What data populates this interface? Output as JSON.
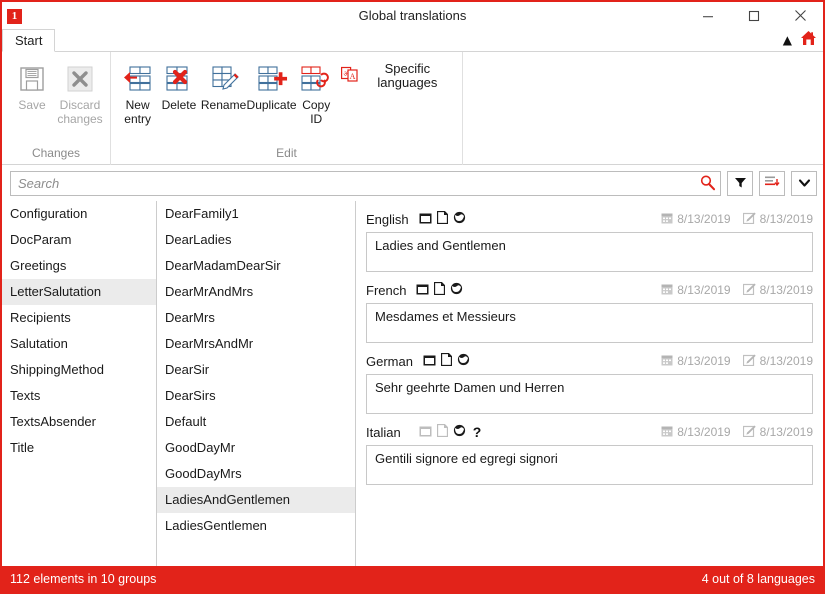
{
  "window": {
    "title": "Global translations",
    "app_icon": "1",
    "controls": {
      "minimize": "minimize-icon",
      "maximize": "maximize-icon",
      "close": "close-icon"
    }
  },
  "ribbon": {
    "tab": "Start",
    "collapse_icon": "chevron-up-icon",
    "home_icon": "home-icon",
    "groups": [
      {
        "label": "Changes",
        "buttons": [
          {
            "label": "Save",
            "icon": "save-floppy-icon",
            "disabled": true
          },
          {
            "label": "Discard changes",
            "icon": "discard-x-icon",
            "disabled": true
          }
        ]
      },
      {
        "label": "Edit",
        "buttons": [
          {
            "label": "New entry",
            "icon": "new-entry-icon",
            "disabled": false
          },
          {
            "label": "Delete",
            "icon": "delete-icon",
            "disabled": false
          },
          {
            "label": "Rename",
            "icon": "rename-icon",
            "disabled": false
          },
          {
            "label": "Duplicate",
            "icon": "duplicate-icon",
            "disabled": false
          },
          {
            "label": "Copy ID",
            "icon": "copy-id-icon",
            "disabled": false
          }
        ],
        "inline_buttons": [
          {
            "label": "Specific languages",
            "icon": "specific-languages-icon"
          }
        ]
      }
    ]
  },
  "search": {
    "value": "",
    "placeholder": "Search",
    "search_icon": "search-icon",
    "filter_icon": "filter-funnel-icon",
    "sort_icon": "sort-descending-icon",
    "more_icon": "chevron-down-icon"
  },
  "groups_list": {
    "selected": "LetterSalutation",
    "items": [
      {
        "label": "Configuration"
      },
      {
        "label": "DocParam"
      },
      {
        "label": "Greetings"
      },
      {
        "label": "LetterSalutation"
      },
      {
        "label": "Recipients"
      },
      {
        "label": "Salutation"
      },
      {
        "label": "ShippingMethod"
      },
      {
        "label": "Texts"
      },
      {
        "label": "TextsAbsender"
      },
      {
        "label": "Title"
      }
    ]
  },
  "entries_list": {
    "selected": "LadiesAndGentlemen",
    "items": [
      {
        "label": "DearFamily1"
      },
      {
        "label": "DearLadies"
      },
      {
        "label": "DearMadamDearSir"
      },
      {
        "label": "DearMrAndMrs"
      },
      {
        "label": "DearMrs"
      },
      {
        "label": "DearMrsAndMr"
      },
      {
        "label": "DearSir"
      },
      {
        "label": "DearSirs"
      },
      {
        "label": "Default"
      },
      {
        "label": "GoodDayMr"
      },
      {
        "label": "GoodDayMrs"
      },
      {
        "label": "LadiesAndGentlemen"
      },
      {
        "label": "LadiesGentlemen"
      }
    ]
  },
  "detail": {
    "languages": [
      {
        "name": "English",
        "value": "Ladies and Gentlemen",
        "icons": [
          "window-icon",
          "document-icon",
          "globe-icon"
        ],
        "icons_disabled": false,
        "has_question": false,
        "created_date": "8/13/2019",
        "modified_date": "8/13/2019",
        "created_icon": "calendar-icon",
        "modified_icon": "edit-pencil-icon"
      },
      {
        "name": "French",
        "value": "Mesdames et Messieurs",
        "icons": [
          "window-icon",
          "document-icon",
          "globe-icon"
        ],
        "icons_disabled": false,
        "has_question": false,
        "created_date": "8/13/2019",
        "modified_date": "8/13/2019",
        "created_icon": "calendar-icon",
        "modified_icon": "edit-pencil-icon"
      },
      {
        "name": "German",
        "value": "Sehr geehrte Damen und Herren",
        "icons": [
          "window-icon",
          "document-icon",
          "globe-icon"
        ],
        "icons_disabled": false,
        "has_question": false,
        "created_date": "8/13/2019",
        "modified_date": "8/13/2019",
        "created_icon": "calendar-icon",
        "modified_icon": "edit-pencil-icon"
      },
      {
        "name": "Italian",
        "value": "Gentili signore ed egregi signori",
        "icons": [
          "window-icon",
          "document-icon",
          "globe-icon",
          "question-icon"
        ],
        "icons_disabled": true,
        "has_question": true,
        "question_label": "?",
        "created_date": "8/13/2019",
        "modified_date": "8/13/2019",
        "created_icon": "calendar-icon",
        "modified_icon": "edit-pencil-icon"
      }
    ]
  },
  "statusbar": {
    "left": "112 elements in 10 groups",
    "right": "4 out of 8 languages"
  },
  "colors": {
    "accent": "#e2231a",
    "selection": "#ebebeb",
    "border": "#c8c8c8",
    "meta_text": "#a8a8a8"
  }
}
